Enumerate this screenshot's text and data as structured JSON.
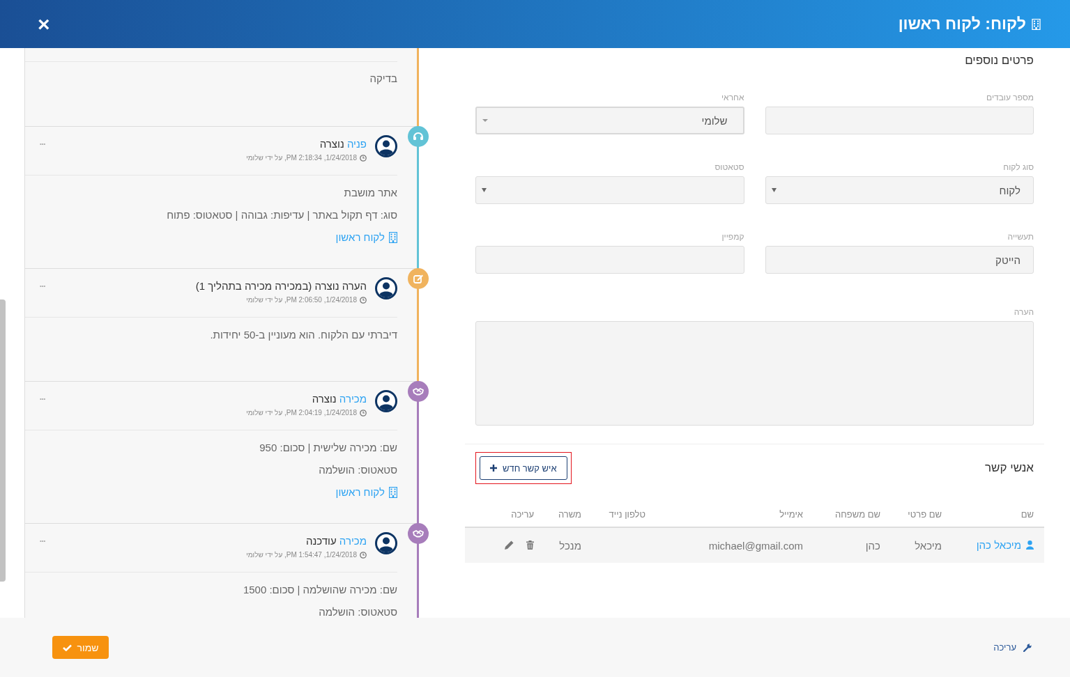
{
  "window": {
    "title": "לקוח: לקוח ראשון",
    "close": "×"
  },
  "timeline": [
    {
      "color": "#f0b35e",
      "body": [
        "בדיקה"
      ]
    },
    {
      "kind": "inquiry",
      "color": "#62c3d6",
      "title_link": "פניה",
      "title": "נוצרה",
      "timestamp": "1/24/2018, 2:18:34 PM, על ידי שלומי",
      "more": "•••",
      "body": [
        "אתר מושבת",
        "סוג: דף תקול באתר | עדיפות: גבוהה | סטאטוס: פתוח"
      ],
      "link": "לקוח ראשון"
    },
    {
      "kind": "note",
      "color": "#f0b35e",
      "title": "הערה נוצרה (במכירה מכירה בתהליך 1)",
      "timestamp": "1/24/2018, 2:06:50 PM, על ידי שלומי",
      "more": "•••",
      "body": [
        "דיברתי עם הלקוח. הוא מעוניין ב-50 יחידות."
      ]
    },
    {
      "kind": "sale",
      "color": "#a77dbb",
      "title_link": "מכירה",
      "title": "נוצרה",
      "timestamp": "1/24/2018, 2:04:19 PM, על ידי שלומי",
      "more": "•••",
      "body": [
        "שם: מכירה שלישית | סכום: 950",
        "סטאטוס: הושלמה"
      ],
      "link": "לקוח ראשון"
    },
    {
      "kind": "sale",
      "color": "#a77dbb",
      "title_link": "מכירה",
      "title": "עודכנה",
      "timestamp": "1/24/2018, 1:54:47 PM, על ידי שלומי",
      "more": "•••",
      "body": [
        "שם: מכירה שהושלמה | סכום: 1500",
        "סטאטוס: הושלמה"
      ]
    }
  ],
  "details": {
    "title": "פרטים נוספים",
    "fields": [
      {
        "label": "מספר עובדים",
        "kind": "text"
      },
      {
        "label": "אחראי",
        "kind": "combo",
        "value": "שלומי"
      },
      {
        "label": "סוג לקוח",
        "kind": "select",
        "value": "לקוח"
      },
      {
        "label": "סטאטוס",
        "kind": "select"
      },
      {
        "label": "תעשייה",
        "kind": "text",
        "value": "הייטק"
      },
      {
        "label": "קמפיין",
        "kind": "text"
      },
      {
        "label": "הערה",
        "kind": "textarea"
      }
    ]
  },
  "contacts": {
    "title": "אנשי קשר",
    "add_button": "איש קשר חדש",
    "columns": [
      "שם",
      "שם פרטי",
      "שם משפחה",
      "אימייל",
      "טלפון נייד",
      "משרה",
      "עריכה"
    ],
    "rows": [
      {
        "name": "מיכאל כהן",
        "first_name": "מיכאל",
        "last_name": "כהן",
        "email": "michael@gmail.com",
        "job": "מנכל"
      }
    ]
  },
  "footer": {
    "save": "שמור",
    "edit": "עריכה"
  }
}
